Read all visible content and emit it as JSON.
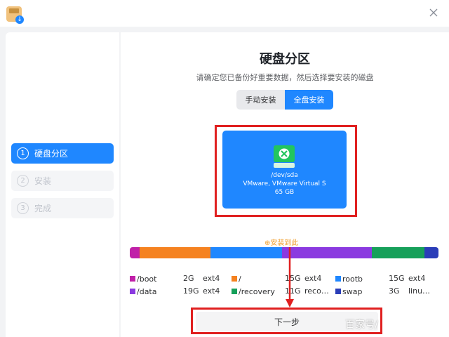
{
  "window": {
    "close_icon": "close-icon",
    "app_icon": "installer-box-icon"
  },
  "sidebar": {
    "steps": [
      {
        "num": "1",
        "label": "硬盘分区"
      },
      {
        "num": "2",
        "label": "安装"
      },
      {
        "num": "3",
        "label": "完成"
      }
    ]
  },
  "main": {
    "title": "硬盘分区",
    "subtitle": "请确定您已备份好重要数据，然后选择要安装的磁盘",
    "modes": {
      "manual": "手动安装",
      "full": "全盘安装"
    },
    "disk": {
      "icon": "disk-icon",
      "path": "/dev/sda",
      "model": "VMware,  VMware  Virtual  S",
      "size": "65  GB"
    },
    "install_here": "安装到此",
    "partitions": [
      {
        "name": "/boot",
        "size": "2G",
        "fs": "ext4",
        "color": "#c020a8",
        "weight": 2
      },
      {
        "name": "/",
        "size": "15G",
        "fs": "ext4",
        "color": "#f58220",
        "weight": 15
      },
      {
        "name": "rootb",
        "size": "15G",
        "fs": "ext4",
        "color": "#1f87ff",
        "weight": 15
      },
      {
        "name": "/data",
        "size": "19G",
        "fs": "ext4",
        "color": "#8b3ae0",
        "weight": 19
      },
      {
        "name": "/recovery",
        "size": "11G",
        "fs": "reco…",
        "color": "#16a05a",
        "weight": 11
      },
      {
        "name": "swap",
        "size": "3G",
        "fs": "linu…",
        "color": "#2a3db8",
        "weight": 3
      }
    ],
    "next_label": "下一步"
  },
  "watermark": "百家号/",
  "colors": {
    "accent": "#1f87ff",
    "annotation": "#e02020"
  }
}
